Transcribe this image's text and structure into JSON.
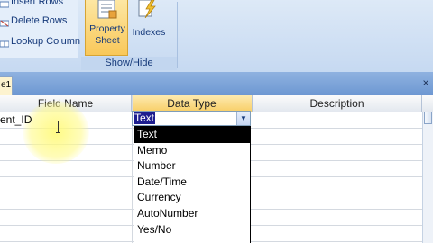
{
  "ribbon": {
    "commands": [
      "Insert Rows",
      "Delete Rows",
      "Lookup Column"
    ],
    "property_sheet_label": "Property Sheet",
    "indexes_label": "Indexes",
    "group_label": "Show/Hide"
  },
  "tabs": {
    "active_label": "e1",
    "close_glyph": "×"
  },
  "grid": {
    "headers": {
      "field_name": "Field Name",
      "data_type": "Data Type",
      "description": "Description"
    },
    "first_row_field_name": "ent_ID"
  },
  "combo": {
    "value": "Text",
    "arrow": "▼"
  },
  "dropdown": {
    "options": [
      "Text",
      "Memo",
      "Number",
      "Date/Time",
      "Currency",
      "AutoNumber",
      "Yes/No"
    ],
    "selected": "Text"
  },
  "colors": {
    "ribbon_bg": "#dde9f7",
    "highlight": "#fff57a",
    "selection": "#1d1d8f"
  }
}
